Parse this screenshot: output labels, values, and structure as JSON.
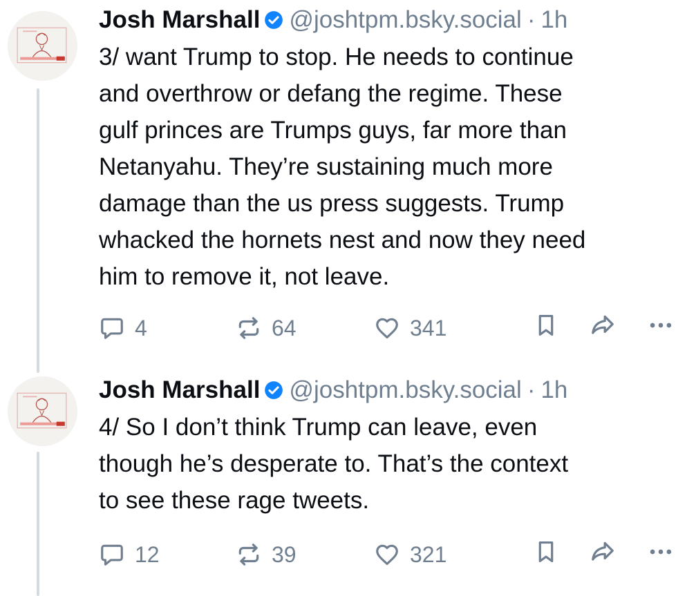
{
  "posts": [
    {
      "author": {
        "display_name": "Josh Marshall",
        "handle": "@joshtpm.bsky.social",
        "verified": true
      },
      "separator": "·",
      "time": "1h",
      "text": "3/ want Trump to stop. He needs to continue\nand overthrow or defang the regime. These\ngulf princes are Trumps guys, far more than\nNetanyahu. They’re sustaining much more\ndamage than the us press suggests. Trump\nwhacked the hornets nest and now they need\nhim to remove it, not leave.",
      "stats": {
        "replies": "4",
        "reposts": "64",
        "likes": "341"
      }
    },
    {
      "author": {
        "display_name": "Josh Marshall",
        "handle": "@joshtpm.bsky.social",
        "verified": true
      },
      "separator": "·",
      "time": "1h",
      "text": "4/ So I don’t think Trump can leave, even\nthough he’s desperate to. That’s the context\nto see these rage tweets.",
      "stats": {
        "replies": "12",
        "reposts": "39",
        "likes": "321"
      }
    }
  ],
  "icons": {
    "reply": "reply-icon",
    "repost": "repost-icon",
    "like": "heart-icon",
    "bookmark": "bookmark-icon",
    "share": "share-icon",
    "more": "more-icon",
    "verified": "verified-badge-icon"
  },
  "colors": {
    "text": "#0b0f14",
    "muted": "#6f7f8f",
    "verified": "#1083fe",
    "thread_line": "#d4dbe2"
  }
}
